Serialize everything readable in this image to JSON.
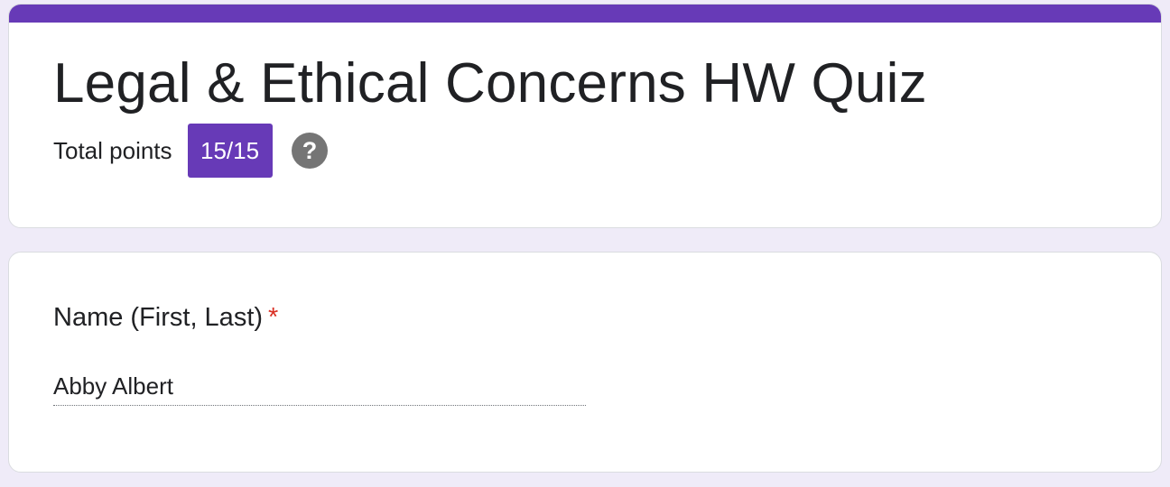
{
  "colors": {
    "page_background": "#efebf8",
    "accent": "#673ab7",
    "required": "#d93025",
    "help_icon": "#757575"
  },
  "quiz": {
    "title": "Legal & Ethical Concerns HW Quiz",
    "points_label": "Total points",
    "points_score": "15/15",
    "help_icon": "help-circle-icon"
  },
  "question": {
    "label": "Name (First, Last)",
    "required_marker": "*",
    "answer": "Abby Albert"
  }
}
